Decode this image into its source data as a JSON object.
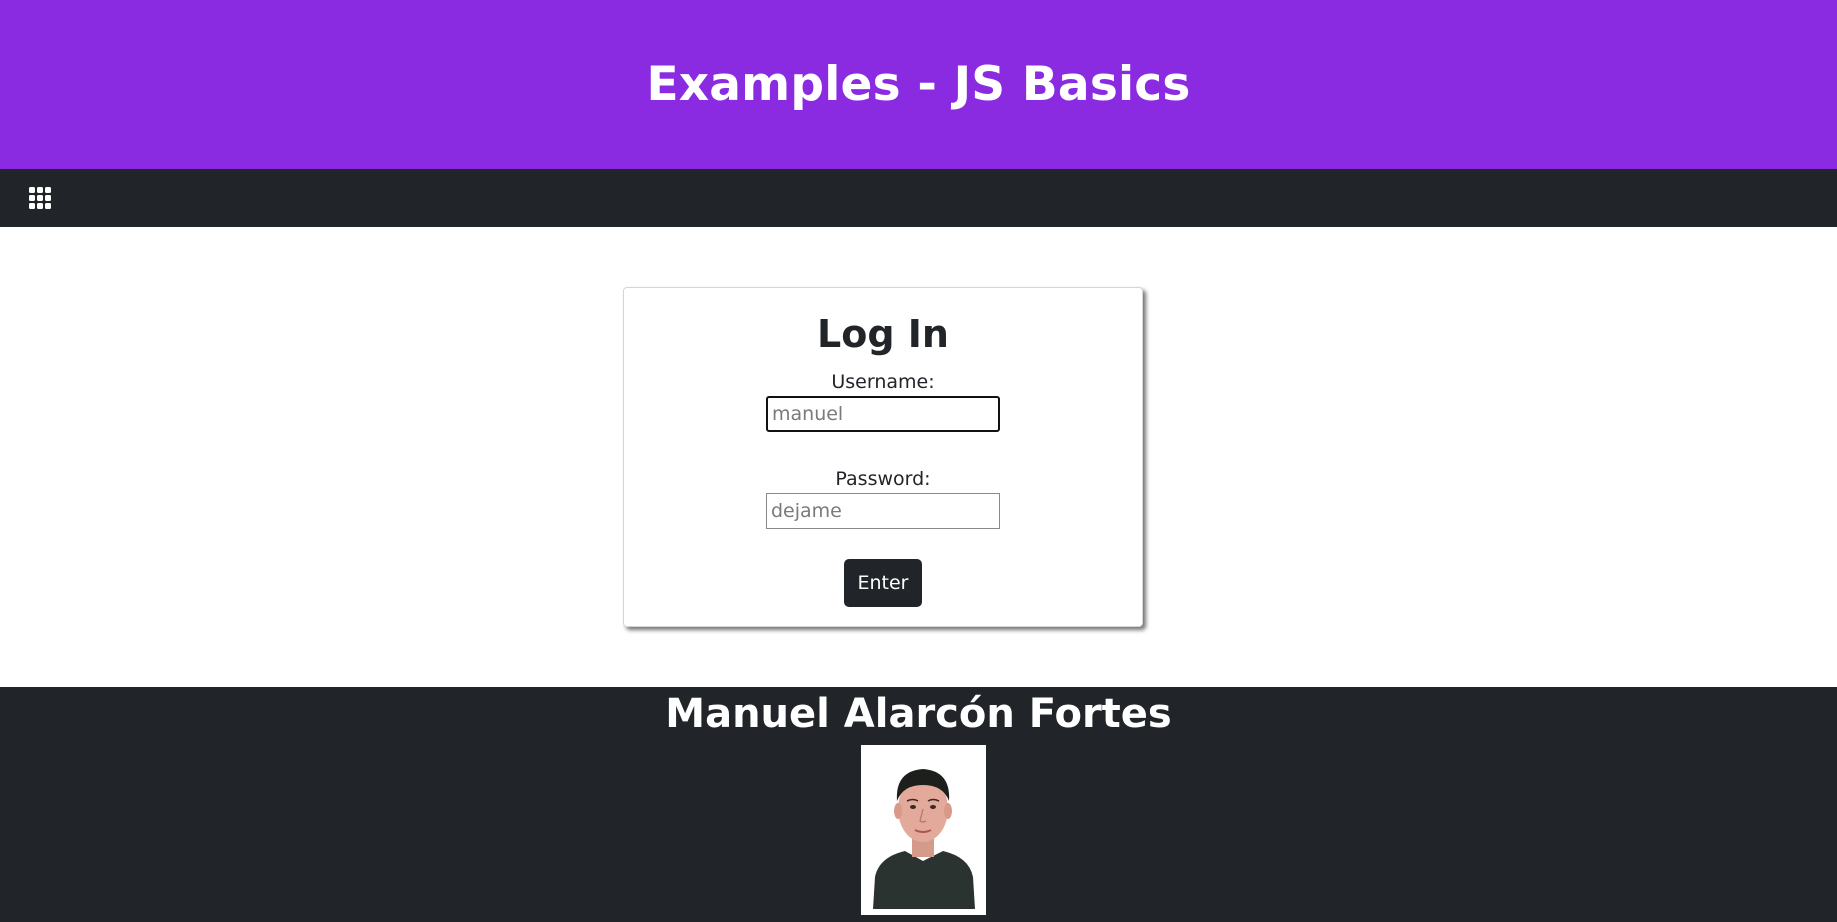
{
  "header": {
    "title": "Examples - JS Basics"
  },
  "navbar": {
    "menu_icon": "apps-grid-icon"
  },
  "login": {
    "title": "Log In",
    "username_label": "Username:",
    "username_placeholder": "manuel",
    "password_label": "Password:",
    "password_placeholder": "dejame",
    "submit_label": "Enter"
  },
  "footer": {
    "author_name": "Manuel Alarcón Fortes",
    "photo": "author-portrait"
  },
  "colors": {
    "banner": "#8a2be2",
    "dark": "#212529",
    "white": "#ffffff"
  }
}
